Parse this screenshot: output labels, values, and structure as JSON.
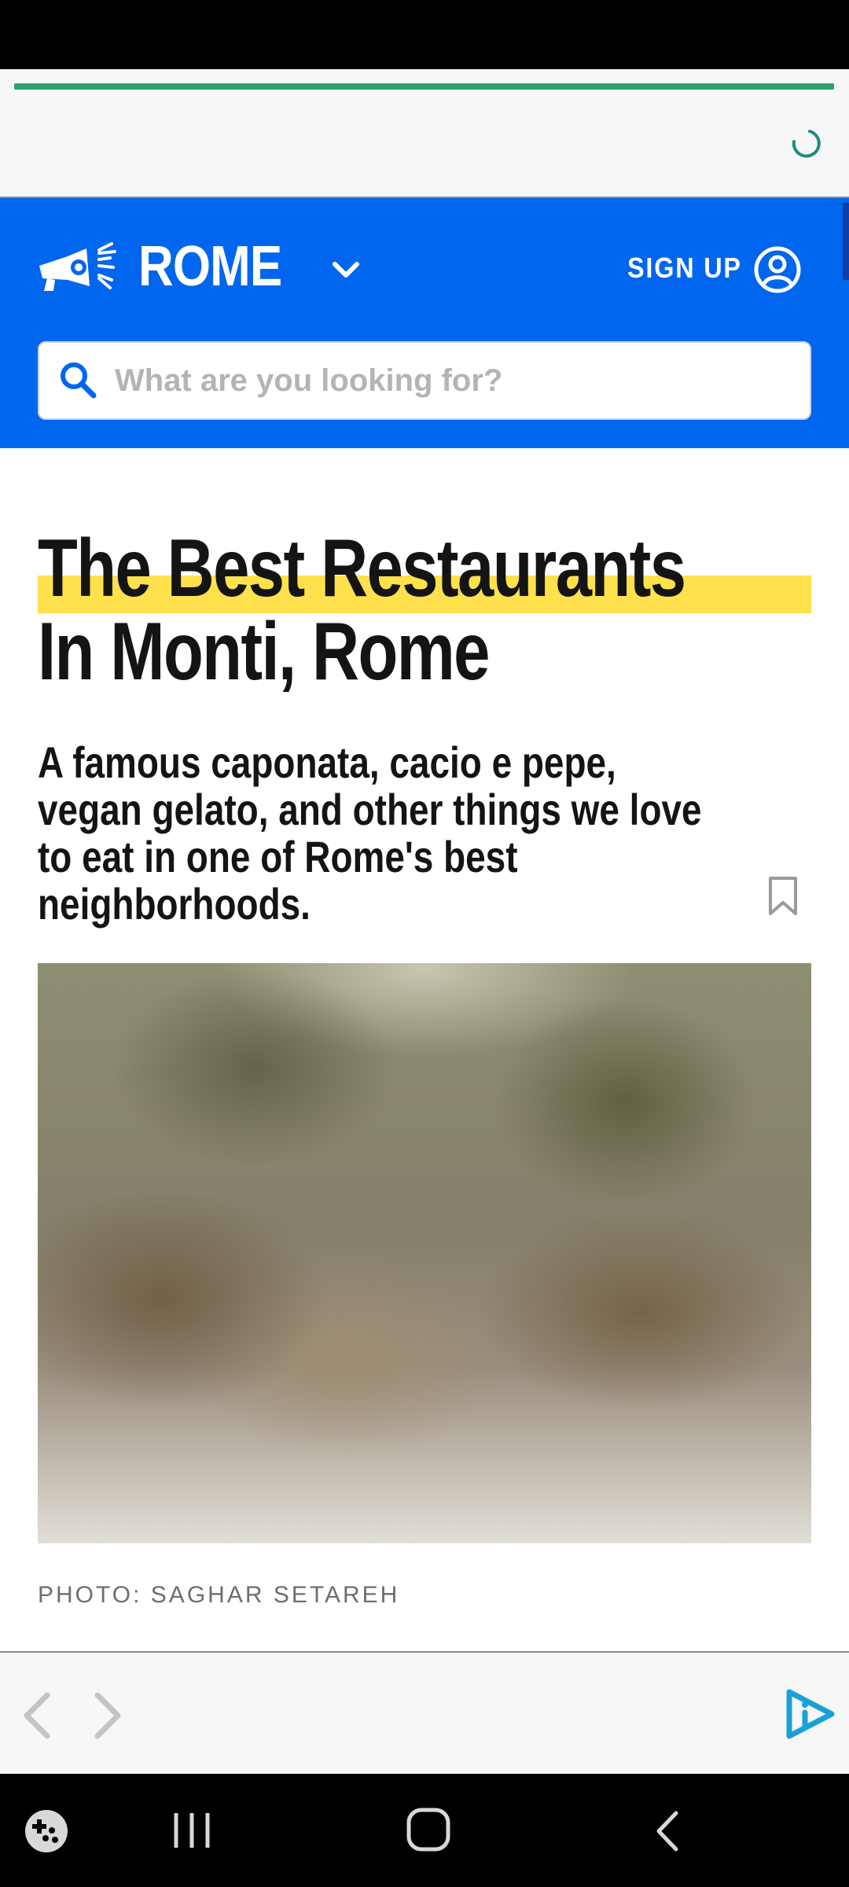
{
  "header": {
    "city": "ROME",
    "signup_label": "SIGN UP",
    "brand_color": "#0066ee",
    "icons": [
      "megaphone-logo-icon",
      "chevron-down-icon",
      "account-circle-icon"
    ]
  },
  "search": {
    "placeholder": "What are you looking for?",
    "value": ""
  },
  "article": {
    "title": "The Best Restaurants In Monti, Rome",
    "highlight_color": "#ffe14d",
    "subtitle": "A famous caponata, cacio e pepe, vegan gelato, and other things we love to eat in one of Rome's best neighborhoods.",
    "photo_credit": "PHOTO: SAGHAR SETAREH"
  },
  "browser": {
    "load_progress": 1.0,
    "load_color": "#2e9e6a",
    "icons": [
      "loading-spinner-icon",
      "back-arrow-icon",
      "forward-arrow-icon",
      "brand-play-icon"
    ]
  },
  "system_nav": {
    "icons": [
      "game-launcher-icon",
      "recents-icon",
      "home-icon",
      "back-icon"
    ]
  }
}
